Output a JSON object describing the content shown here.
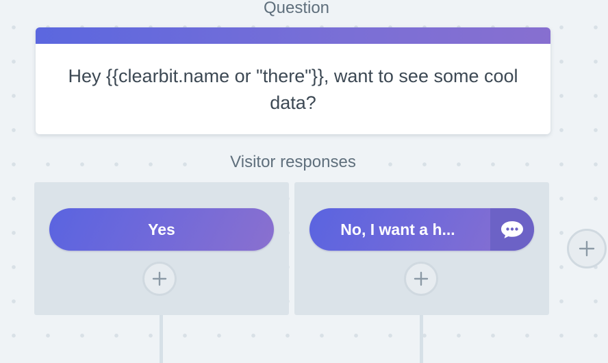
{
  "question": {
    "label": "Question",
    "text": "Hey {{clearbit.name or \"there\"}}, want to see some cool data?"
  },
  "responses": {
    "label": "Visitor responses",
    "items": [
      {
        "label": "Yes",
        "has_chat_icon": false
      },
      {
        "label": "No, I want a h...",
        "has_chat_icon": true
      }
    ]
  },
  "icons": {
    "add": "plus-icon",
    "chat": "chat-bubble-icon"
  },
  "colors": {
    "background": "#eff3f6",
    "accent_start": "#5a64e0",
    "accent_end": "#8a70cf",
    "panel": "#dbe3e9",
    "text": "#3c4853",
    "muted_text": "#5f6f7c"
  }
}
